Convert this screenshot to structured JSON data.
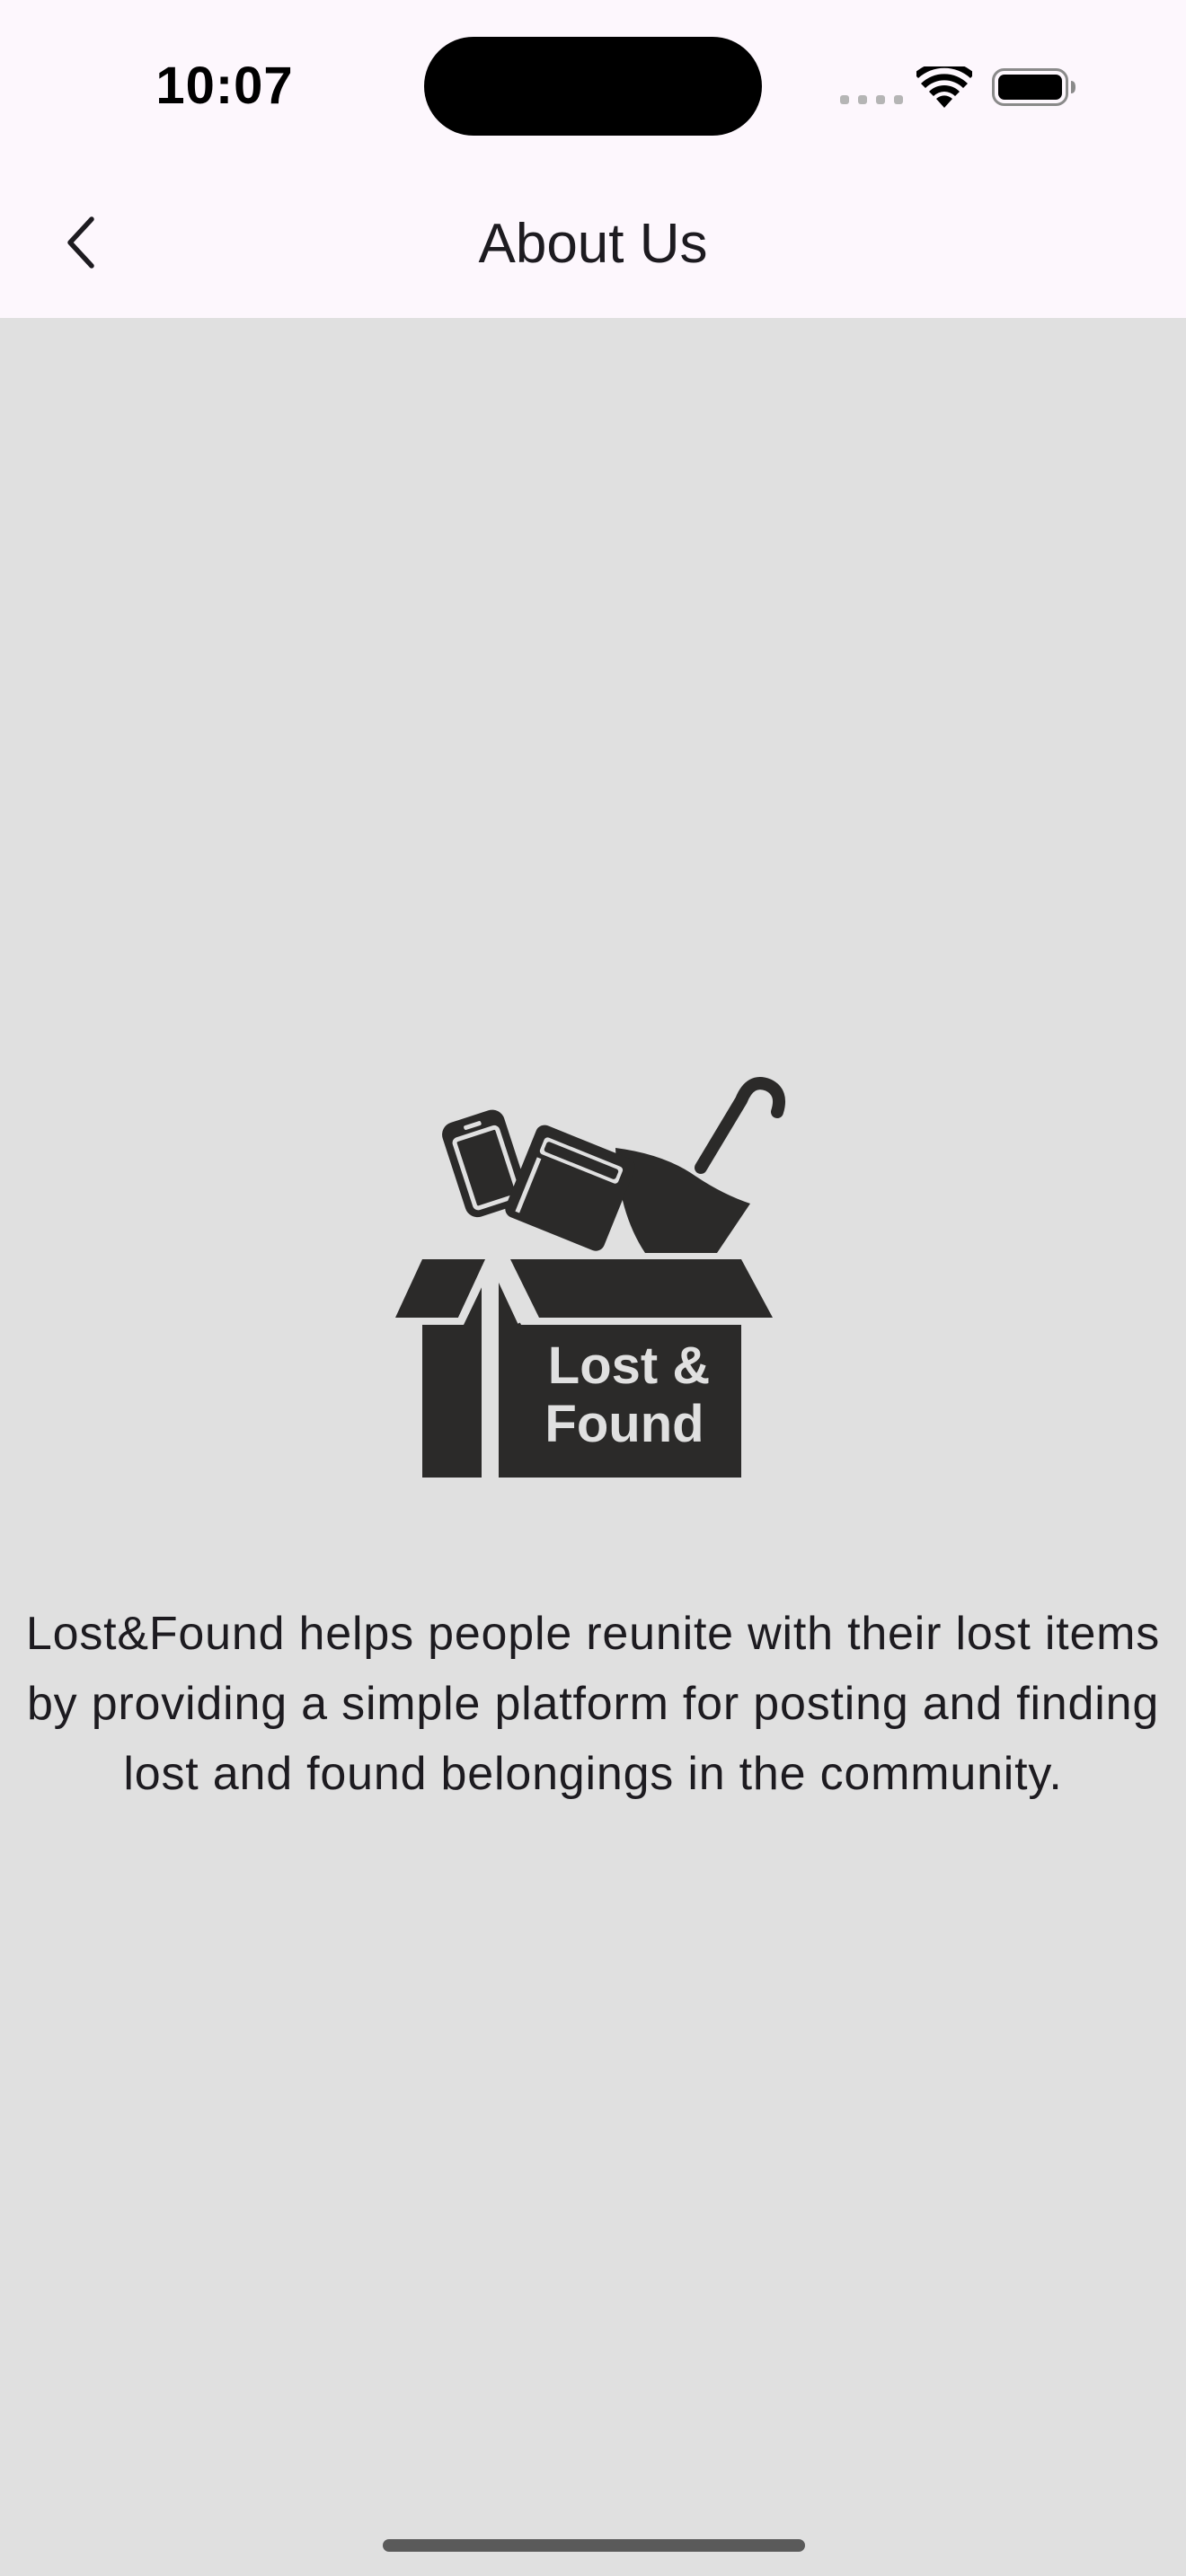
{
  "status_bar": {
    "time": "10:07"
  },
  "app_bar": {
    "title": "About Us",
    "back_icon": "chevron-left-icon"
  },
  "logo": {
    "line1": "Lost &",
    "line2": "Found",
    "icon": "box-with-phone-book-umbrella-icon",
    "fill_color": "#2b2a29",
    "text_color": "#e0e0e0"
  },
  "description": "Lost&Found helps people reunite with their lost items by providing a simple platform for posting and finding lost and found belongings in the community.",
  "colors": {
    "background": "#e0e0e0",
    "app_bar": "#fdf7fd",
    "text": "#1d1b20"
  }
}
